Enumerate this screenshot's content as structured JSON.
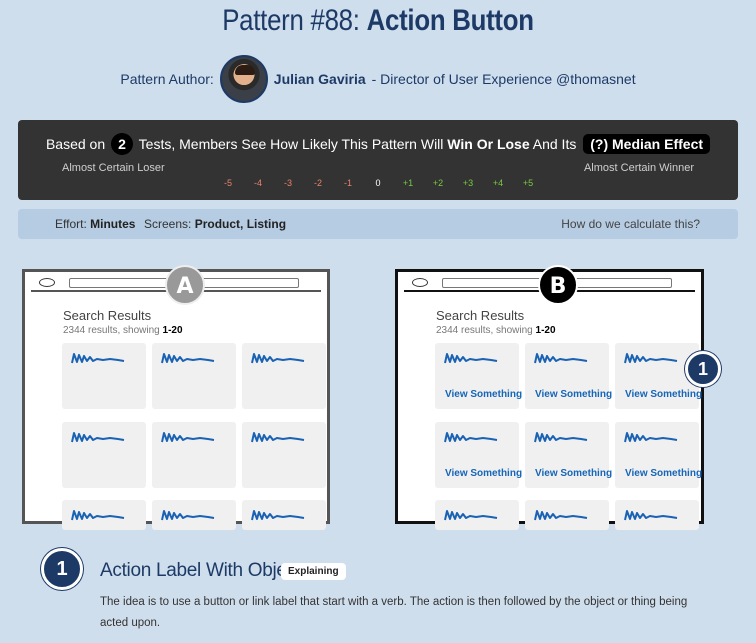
{
  "header": {
    "title_prefix": "Pattern #88: ",
    "title_main": "Action Button"
  },
  "author": {
    "label": "Pattern Author:",
    "name": "Julian Gaviria",
    "role": "- Director of User Experience @thomasnet"
  },
  "scale": {
    "text_before": "Based on",
    "tests_count": "2",
    "text_middle": "Tests, Members See How Likely This Pattern Will",
    "text_bold": "Win Or Lose",
    "text_after": "And Its",
    "effect_label": "(?) Median Effect",
    "low_label": "Almost Certain Loser",
    "high_label": "Almost Certain Winner",
    "ticks": [
      "-5",
      "-4",
      "-3",
      "-2",
      "-1",
      "0",
      "+1",
      "+2",
      "+3",
      "+4",
      "+5"
    ]
  },
  "effort": {
    "effort_label": "Effort:",
    "effort_value": "Minutes",
    "screens_label": "Screens:",
    "screens_value": "Product, Listing",
    "calc_link": "How do we calculate this?"
  },
  "variant_a": {
    "badge": "A",
    "results_title": "Search Results",
    "results_count_prefix": "2344 results, showing ",
    "results_count_range": "1-20"
  },
  "variant_b": {
    "badge": "B",
    "results_title": "Search Results",
    "results_count_prefix": "2344 results, showing ",
    "results_count_range": "1-20",
    "link_label": "View Something",
    "marker": "1"
  },
  "explanation": {
    "marker": "1",
    "title": "Action Label With Object",
    "tag": "Explaining",
    "body": "The idea is to use a button or link label that start with a verb. The action is then followed by the object or thing being acted upon."
  },
  "colors": {
    "background": "#cfdeed",
    "navy": "#1d3a66",
    "link_blue": "#1565b8",
    "negative": "#e8826c",
    "positive": "#7ac943"
  }
}
